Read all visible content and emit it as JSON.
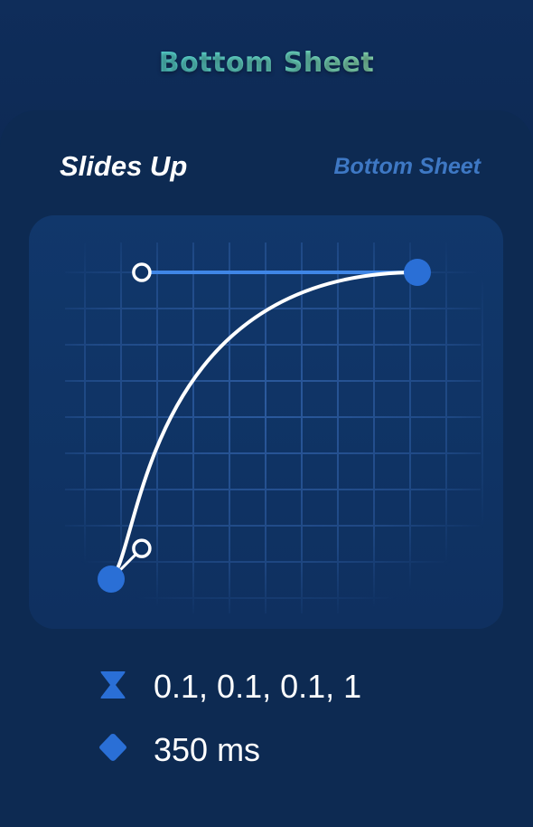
{
  "header": {
    "title": "Bottom Sheet"
  },
  "card": {
    "title": "Slides Up",
    "subtitle": "Bottom Sheet"
  },
  "curve": {
    "p1": [
      0.1,
      0.1
    ],
    "p2": [
      0.1,
      1
    ],
    "line_color": "#ffffff",
    "handle_color": "#2a6fd6",
    "grid_color": "#2c5a9e"
  },
  "meta": {
    "easing_icon": "hourglass-icon",
    "easing_value": "0.1, 0.1, 0.1, 1",
    "duration_icon": "diamond-icon",
    "duration_value": "350 ms"
  }
}
